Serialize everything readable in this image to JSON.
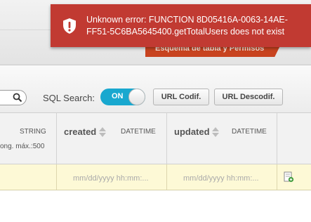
{
  "header": {
    "tab_label": "Esquema de tabla y Permisos",
    "tab_color": "#c8431f"
  },
  "toolbar": {
    "search_icon": "search-icon",
    "sql_search_label": "SQL Search:",
    "sql_toggle_label": "ON",
    "sql_toggle_state": true,
    "toggle_color": "#19a8cf",
    "url_codif_label": "URL Codif.",
    "url_decodif_label": "URL Descodif."
  },
  "grid": {
    "columns": [
      {
        "name": "",
        "type": "STRING",
        "subtext": "ong. máx.:500"
      },
      {
        "name": "created",
        "type": "DATETIME",
        "sortable": true
      },
      {
        "name": "updated",
        "type": "DATETIME",
        "sortable": true
      }
    ],
    "new_row": {
      "created_placeholder": "mm/dd/yyyy hh:mm:...",
      "updated_placeholder": "mm/dd/yyyy hh:mm:...",
      "action_icon": "add-record-icon"
    },
    "row_color": "#fdf9d6"
  },
  "toast": {
    "icon": "shield-alert-icon",
    "message": "Unknown error: FUNCTION 8D05416A-0063-14AE-FF51-5C6BA5645400.getTotalUsers does not exist",
    "color": "#c13a32"
  }
}
